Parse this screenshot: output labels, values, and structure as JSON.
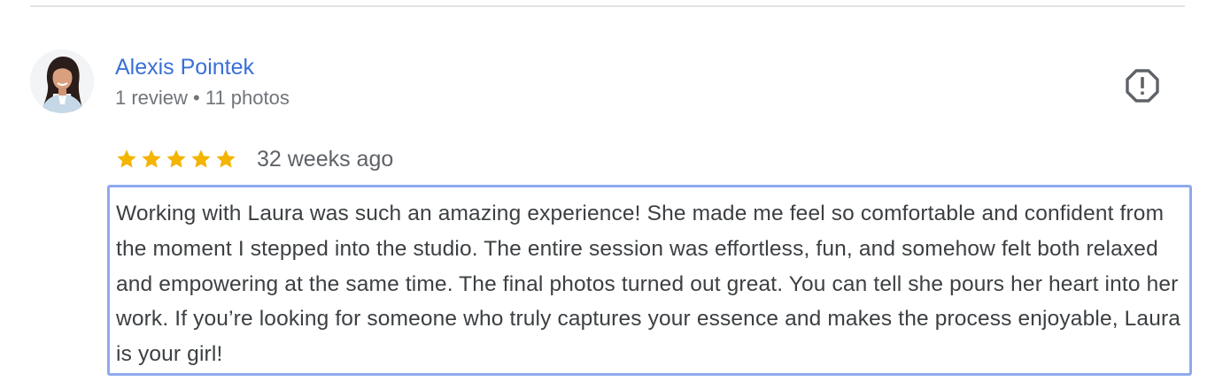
{
  "review": {
    "author": {
      "name": "Alexis Pointek",
      "meta": "1 review • 11 photos",
      "avatar": "profile-photo"
    },
    "report_icon": "flag-octagon-exclamation-icon",
    "rating": {
      "stars": 5,
      "max": 5,
      "star_color": "#f4b400"
    },
    "time": "32 weeks ago",
    "text": "Working with Laura was such an amazing experience! She made me feel so comfortable and confident from the moment I stepped into the studio. The entire session was effortless, fun, and somehow felt both relaxed and empowering at the same time. The final photos turned out great. You can tell she pours her heart into her work. If you’re looking for someone who truly captures your essence and makes the process enjoyable, Laura is your girl!"
  },
  "colors": {
    "link": "#3a6fd8",
    "meta_text": "#70757a",
    "body_text": "#3c4043",
    "highlight_border": "#8fa9ee",
    "divider": "#e3e3e3"
  }
}
